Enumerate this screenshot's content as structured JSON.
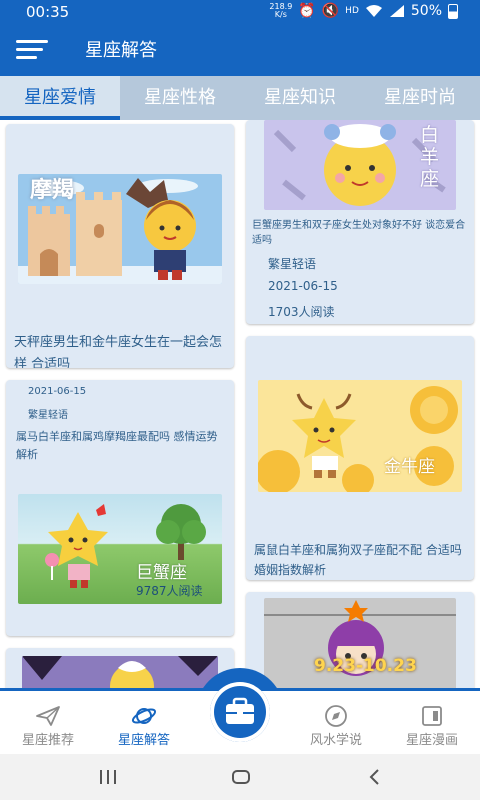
{
  "status_bar": {
    "time": "00:35",
    "speed_value": "218.9",
    "speed_unit": "K/s",
    "net": "HD",
    "battery": "50%"
  },
  "app_bar": {
    "title": "星座解答"
  },
  "tabs": [
    {
      "label": "星座爱情",
      "active": true
    },
    {
      "label": "星座性格",
      "active": false
    },
    {
      "label": "星座知识",
      "active": false
    },
    {
      "label": "星座时尚",
      "active": false
    }
  ],
  "cards": {
    "capricorn": {
      "image_text": "摩羯",
      "title": "天秤座男生和金牛座女生在一起会怎样 合适吗"
    },
    "aries": {
      "image_text": "白羊座",
      "title": "巨蟹座男生和双子座女生处对象好不好 谈恋爱合适吗",
      "author": "繁星轻语",
      "date": "2021-06-15",
      "reads": "1703人阅读"
    },
    "cancer": {
      "date": "2021-06-15",
      "author": "繁星轻语",
      "title": "属马白羊座和属鸡摩羯座最配吗 感情运势解析",
      "image_text": "巨蟹座",
      "reads": "9787人阅读"
    },
    "taurus": {
      "image_text": "金牛座",
      "title": "属鼠白羊座和属狗双子座配不配 合适吗 婚姻指数解析"
    },
    "virgo": {
      "image_text": "9.23-10.23"
    }
  },
  "bottom_nav": [
    {
      "label": "星座推荐",
      "icon": "paper-plane-icon",
      "active": false
    },
    {
      "label": "星座解答",
      "icon": "planet-icon",
      "active": true
    },
    {
      "label": "风水学说",
      "icon": "compass-icon",
      "active": false
    },
    {
      "label": "星座漫画",
      "icon": "comic-icon",
      "active": false
    }
  ],
  "colors": {
    "primary": "#1565c0",
    "tab_bar": "#b5c8db",
    "card": "#dfe9f5",
    "text": "#2f5f8a"
  }
}
